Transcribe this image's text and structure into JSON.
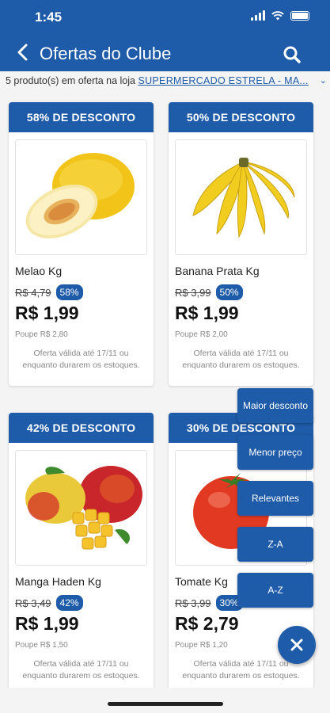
{
  "status_bar": {
    "time": "1:45"
  },
  "header": {
    "title": "Ofertas do Clube"
  },
  "info": {
    "prefix": "5 produto(s) em oferta na loja ",
    "store": "SUPERMERCADO ESTRELA - MA..."
  },
  "products": [
    {
      "banner": "58% DE DESCONTO",
      "name": "Melao Kg",
      "old_price": "R$ 4,79",
      "discount": "58%",
      "price": "R$ 1,99",
      "savings": "Poupe R$ 2,80",
      "validity": "Oferta válida até 17/11 ou enquanto durarem os estoques."
    },
    {
      "banner": "50% DE DESCONTO",
      "name": "Banana Prata Kg",
      "old_price": "R$ 3,99",
      "discount": "50%",
      "price": "R$ 1,99",
      "savings": "Poupe R$ 2,00",
      "validity": "Oferta válida até 17/11 ou enquanto durarem os estoques."
    },
    {
      "banner": "42% DE DESCONTO",
      "name": "Manga Haden Kg",
      "old_price": "R$ 3,49",
      "discount": "42%",
      "price": "R$ 1,99",
      "savings": "Poupe R$ 1,50",
      "validity": "Oferta válida até 17/11 ou enquanto durarem os estoques."
    },
    {
      "banner": "30% DE DESCONTO",
      "name": "Tomate Kg",
      "old_price": "R$ 3,99",
      "discount": "30%",
      "price": "R$ 2,79",
      "savings": "Poupe R$ 1,20",
      "validity": "Oferta válida até 17/11 ou enquanto durarem os estoques."
    }
  ],
  "sort_menu": [
    "Maior desconto",
    "Menor preço",
    "Relevantes",
    "Z-A",
    "A-Z"
  ],
  "colors": {
    "primary": "#1e5ba8"
  }
}
